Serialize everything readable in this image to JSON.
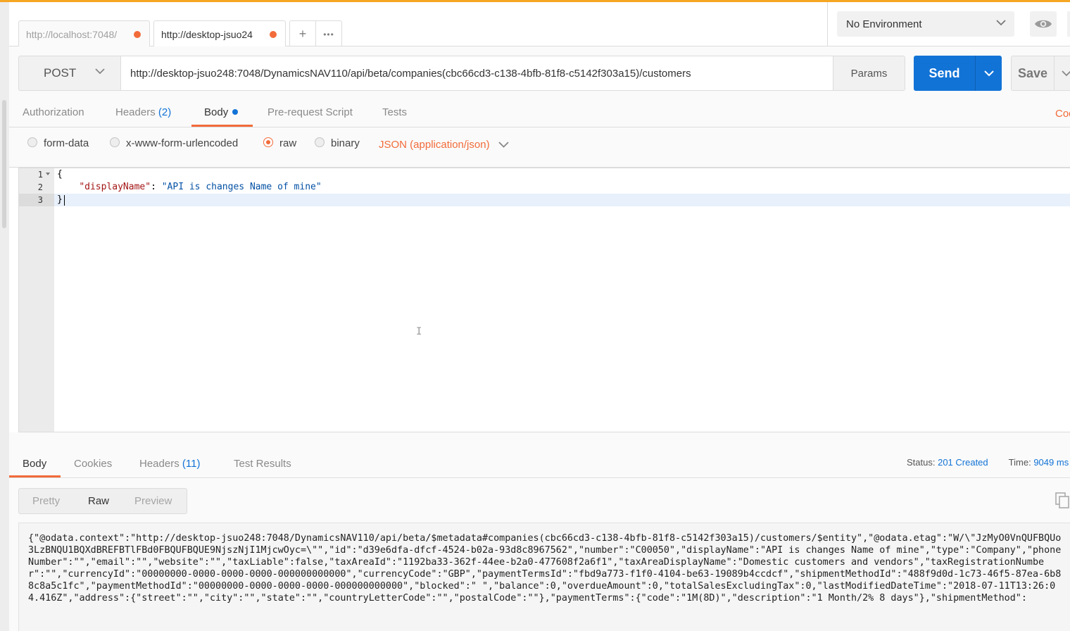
{
  "tabs": [
    {
      "label": "http://localhost:7048/"
    },
    {
      "label": "http://desktop-jsuo24"
    }
  ],
  "tab_actions": {
    "add": "+",
    "more": "•••"
  },
  "environment": {
    "selected": "No Environment"
  },
  "request": {
    "method": "POST",
    "url": "http://desktop-jsuo248:7048/DynamicsNAV110/api/beta/companies(cbc66cd3-c138-4bfb-81f8-c5142f303a15)/customers",
    "params_label": "Params",
    "send_label": "Send",
    "save_label": "Save"
  },
  "request_subtabs": {
    "authorization": "Authorization",
    "headers": "Headers",
    "headers_count": "(2)",
    "body": "Body",
    "prerequest": "Pre-request Script",
    "tests": "Tests",
    "code_link": "Code"
  },
  "body_types": {
    "form_data": "form-data",
    "urlencoded": "x-www-form-urlencoded",
    "raw": "raw",
    "binary": "binary",
    "selected": "raw",
    "content_type": "JSON (application/json)"
  },
  "editor": {
    "line_numbers": [
      "1",
      "2",
      "3"
    ],
    "line1": "{",
    "line2_key": "\"displayName\"",
    "line2_sep": ": ",
    "line2_value": "\"API is changes Name of mine\"",
    "line3": "}"
  },
  "response_tabs": {
    "body": "Body",
    "cookies": "Cookies",
    "headers": "Headers",
    "headers_count": "(11)",
    "test_results": "Test Results"
  },
  "response_status": {
    "status_label": "Status:",
    "status_value": "201 Created",
    "time_label": "Time:",
    "time_value": "9049 ms"
  },
  "response_view": {
    "pretty": "Pretty",
    "raw": "Raw",
    "preview": "Preview",
    "selected": "Raw"
  },
  "response_body": "{\"@odata.context\":\"http://desktop-jsuo248:7048/DynamicsNAV110/api/beta/$metadata#companies(cbc66cd3-c138-4bfb-81f8-c5142f303a15)/customers/$entity\",\"@odata.etag\":\"W/\\\"JzMyO0VnQUFBQUo3LzBNQU1BQXdBREFBTlFBd0FBQUFBQUE9NjszNjI1MjcwOyc=\\\"\",\"id\":\"d39e6dfa-dfcf-4524-b02a-93d8c8967562\",\"number\":\"C00050\",\"displayName\":\"API is changes Name of mine\",\"type\":\"Company\",\"phoneNumber\":\"\",\"email\":\"\",\"website\":\"\",\"taxLiable\":false,\"taxAreaId\":\"1192ba33-362f-44ee-b2a0-477608f2a6f1\",\"taxAreaDisplayName\":\"Domestic customers and vendors\",\"taxRegistrationNumber\":\"\",\"currencyId\":\"00000000-0000-0000-0000-000000000000\",\"currencyCode\":\"GBP\",\"paymentTermsId\":\"fbd9a773-f1f0-4104-be63-19089b4ccdcf\",\"shipmentMethodId\":\"488f9d0d-1c73-46f5-87ea-6b88c8a5c1fc\",\"paymentMethodId\":\"00000000-0000-0000-0000-000000000000\",\"blocked\":\" \",\"balance\":0,\"overdueAmount\":0,\"totalSalesExcludingTax\":0,\"lastModifiedDateTime\":\"2018-07-11T13:26:04.416Z\",\"address\":{\"street\":\"\",\"city\":\"\",\"state\":\"\",\"countryLetterCode\":\"\",\"postalCode\":\"\"},\"paymentTerms\":{\"code\":\"1M(8D)\",\"description\":\"1 Month/2% 8 days\"},\"shipmentMethod\":",
  "colors": {
    "accent": "#f26b3a",
    "primary": "#1273d6",
    "top_bar": "#f5a623"
  },
  "icons": [
    "chevron-down-icon",
    "eye-icon",
    "copy-icon",
    "plus-icon",
    "more-icon"
  ]
}
